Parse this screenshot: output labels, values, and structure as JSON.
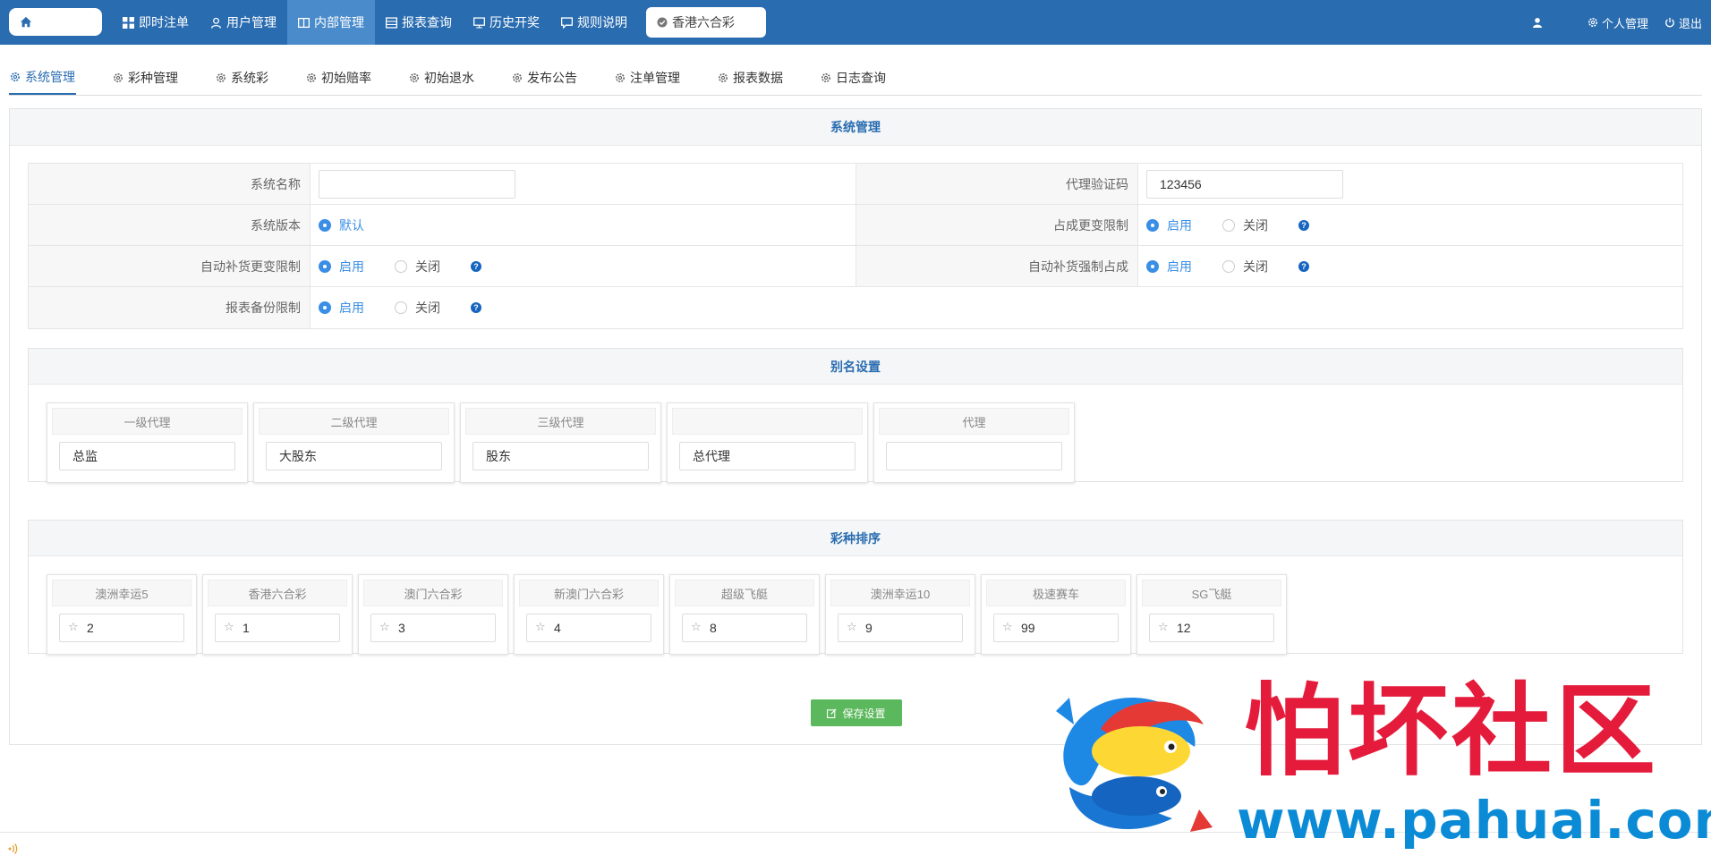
{
  "topbar": {
    "nav": [
      {
        "label": "即时注单",
        "icon": "grid-icon"
      },
      {
        "label": "用户管理",
        "icon": "user-icon"
      },
      {
        "label": "内部管理",
        "icon": "book-icon"
      },
      {
        "label": "报表查询",
        "icon": "table-icon"
      },
      {
        "label": "历史开奖",
        "icon": "monitor-icon"
      },
      {
        "label": "规则说明",
        "icon": "message-icon"
      }
    ],
    "active_tab": "香港六合彩",
    "personal": "个人管理",
    "logout": "退出"
  },
  "subtabs": [
    "系统管理",
    "彩种管理",
    "系统彩",
    "初始赔率",
    "初始退水",
    "发布公告",
    "注单管理",
    "报表数据",
    "日志查询"
  ],
  "panel_title": "系统管理",
  "form": {
    "system_name_label": "系统名称",
    "system_name_value": "",
    "agent_code_label": "代理验证码",
    "agent_code_value": "123456",
    "version_label": "系统版本",
    "version_option": "默认",
    "share_limit_label": "占成更变限制",
    "auto_fill_label": "自动补货更变限制",
    "auto_fill_force_label": "自动补货强制占成",
    "report_backup_label": "报表备份限制",
    "enable": "启用",
    "disable": "关闭"
  },
  "alias": {
    "title": "别名设置",
    "cards": [
      {
        "label": "一级代理",
        "value": "总监"
      },
      {
        "label": "二级代理",
        "value": "大股东"
      },
      {
        "label": "三级代理",
        "value": "股东"
      },
      {
        "label": "",
        "value": "总代理"
      },
      {
        "label": "代理",
        "value": ""
      }
    ]
  },
  "sort": {
    "title": "彩种排序",
    "cards": [
      {
        "label": "澳洲幸运5",
        "value": "2"
      },
      {
        "label": "香港六合彩",
        "value": "1"
      },
      {
        "label": "澳门六合彩",
        "value": "3"
      },
      {
        "label": "新澳门六合彩",
        "value": "4"
      },
      {
        "label": "超级飞艇",
        "value": "8"
      },
      {
        "label": "澳洲幸运10",
        "value": "9"
      },
      {
        "label": "极速赛车",
        "value": "99"
      },
      {
        "label": "SG飞艇",
        "value": "12"
      }
    ]
  },
  "save_label": "保存设置",
  "watermark": {
    "text": "怕坏社区",
    "url": "www.pahuai.com"
  }
}
